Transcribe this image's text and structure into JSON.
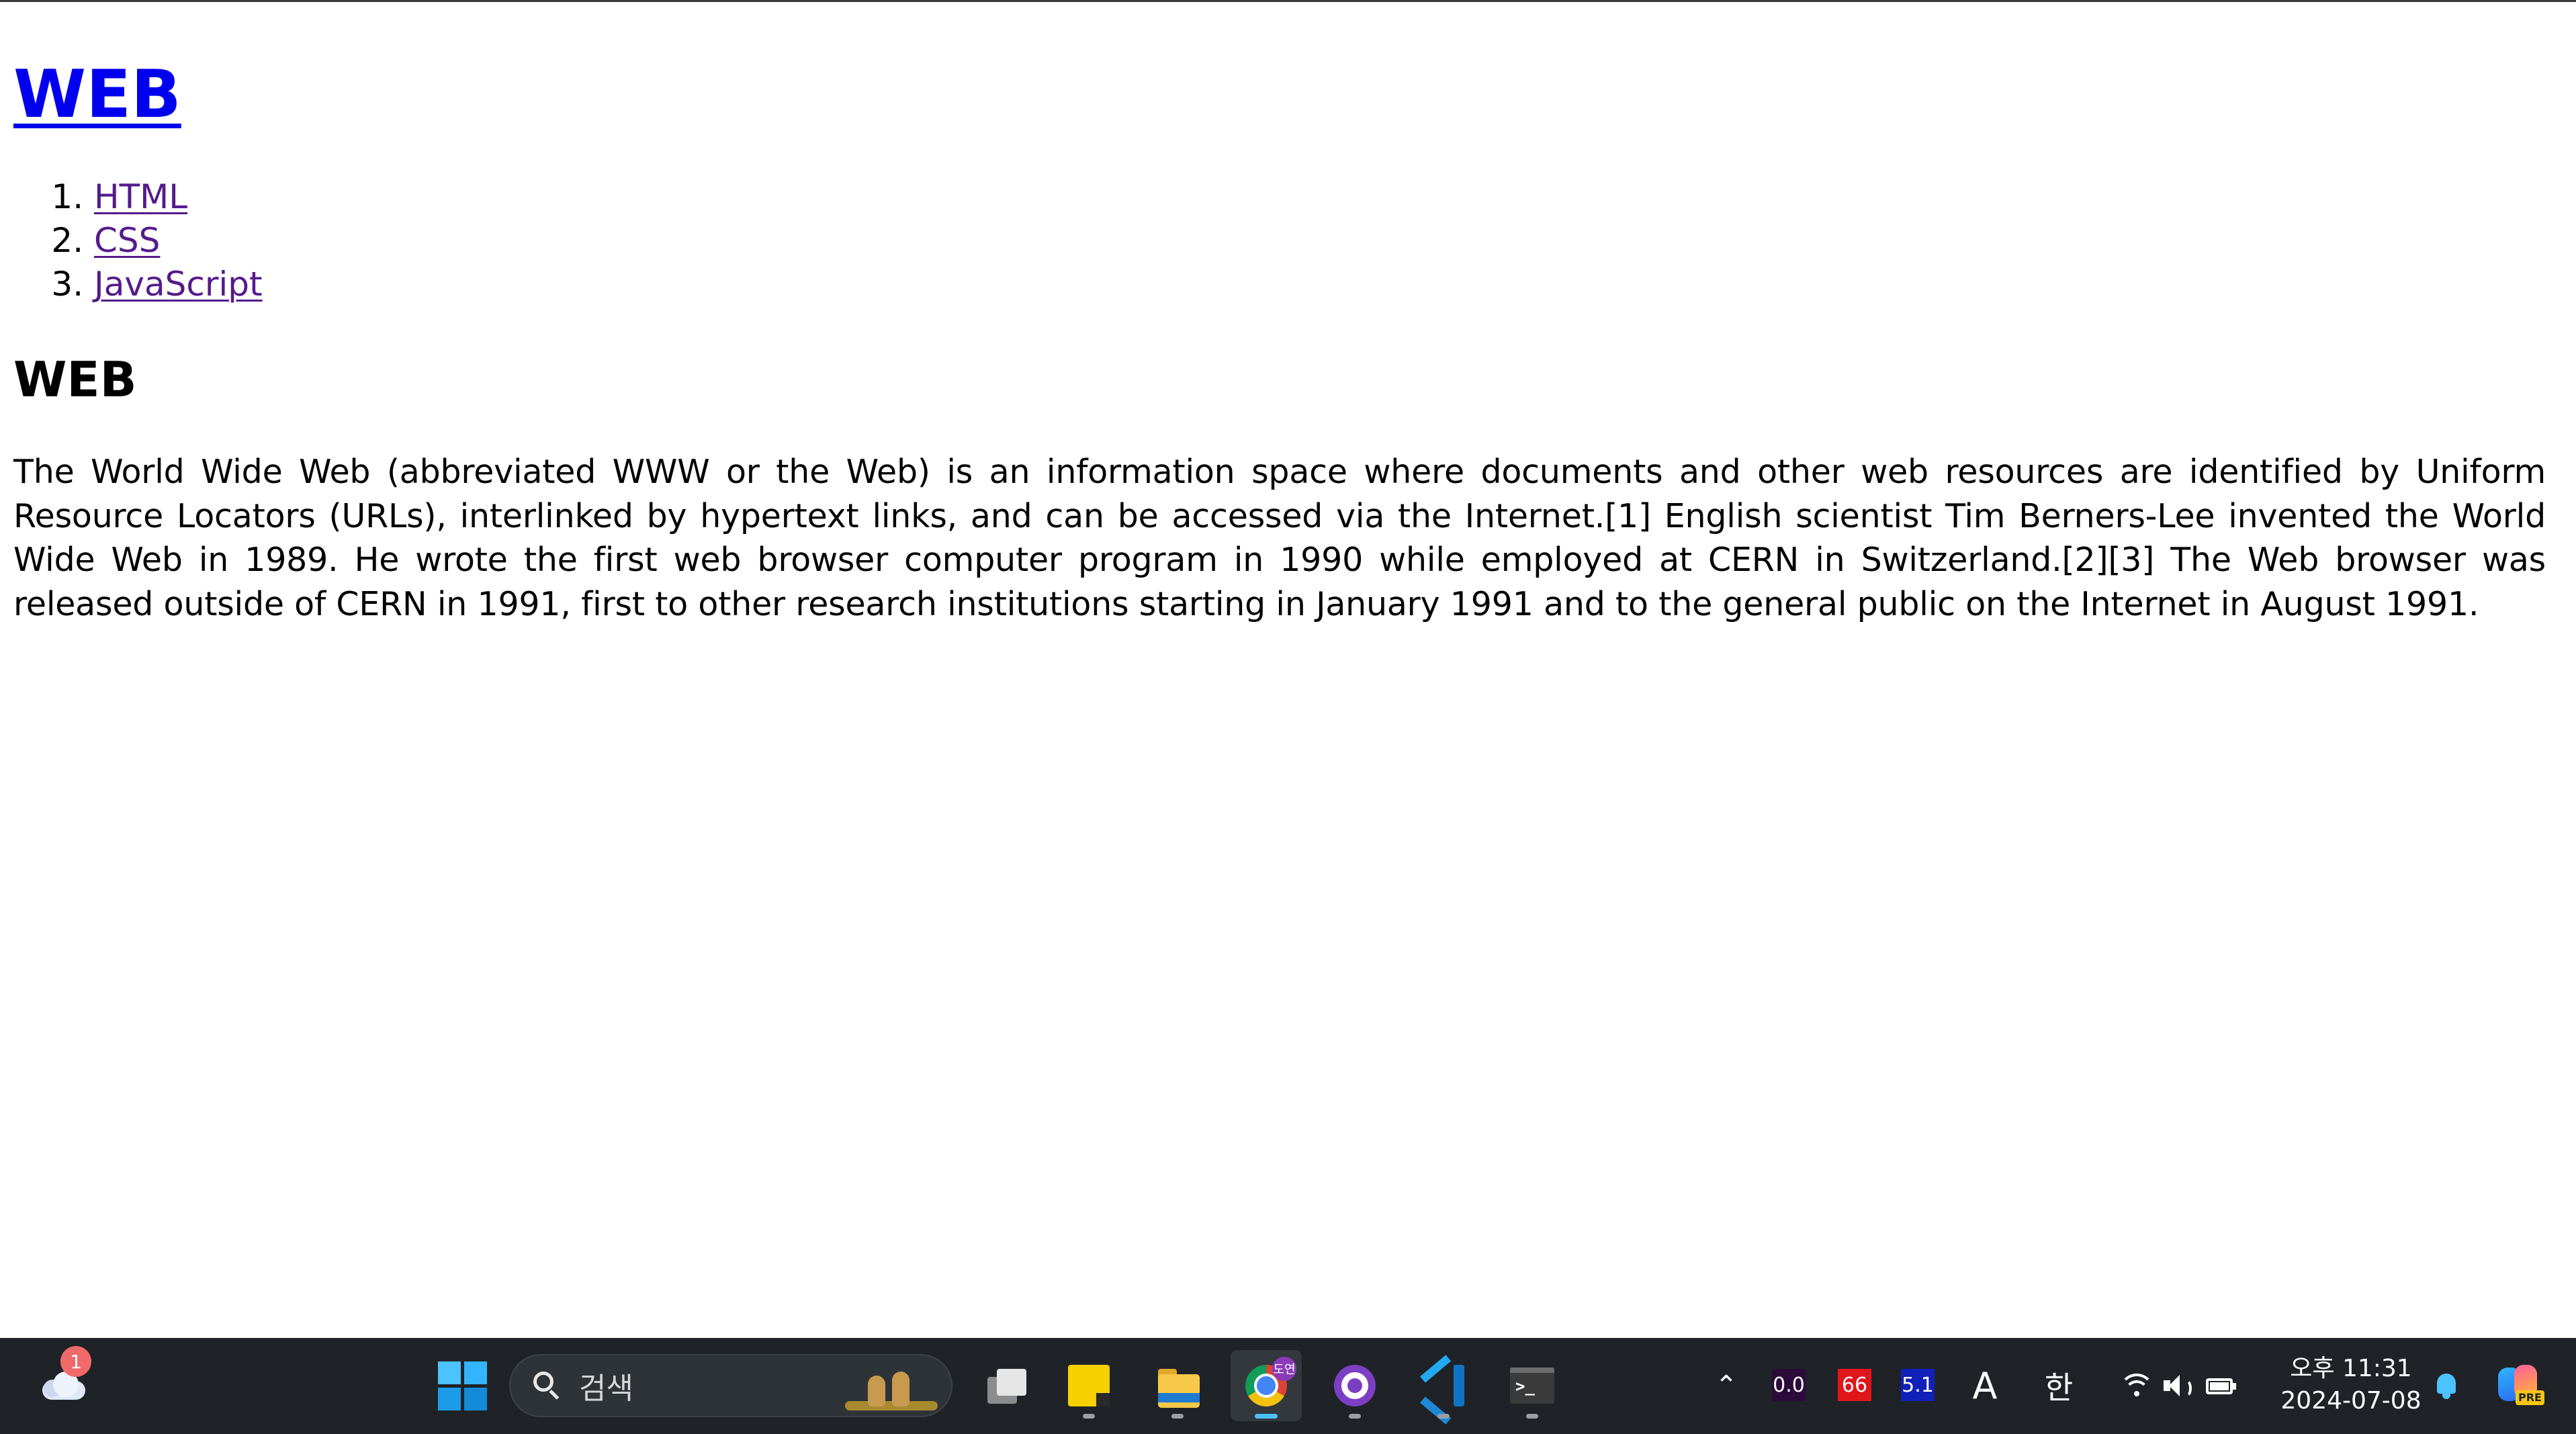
{
  "page": {
    "site_title": "WEB",
    "nav": [
      {
        "label": "HTML"
      },
      {
        "label": "CSS"
      },
      {
        "label": "JavaScript"
      }
    ],
    "section_title": "WEB",
    "article": "The World Wide Web (abbreviated WWW or the Web) is an information space where documents and other web resources are identified by Uniform Resource Locators (URLs), interlinked by hypertext links, and can be accessed via the Internet.[1] English scientist Tim Berners-Lee invented the World Wide Web in 1989. He wrote the first web browser computer program in 1990 while employed at CERN in Switzerland.[2][3] The Web browser was released outside of CERN in 1991, first to other research institutions starting in January 1991 and to the general public on the Internet in August 1991."
  },
  "taskbar": {
    "weather_badge": "1",
    "search_placeholder": "검색",
    "chrome_profile_label": "도연",
    "apps": [
      {
        "icon": "task-view-icon"
      },
      {
        "icon": "sticky-notes-icon"
      },
      {
        "icon": "file-explorer-icon"
      },
      {
        "icon": "chrome-icon",
        "active": true
      },
      {
        "icon": "github-desktop-icon"
      },
      {
        "icon": "vscode-icon"
      },
      {
        "icon": "terminal-icon"
      }
    ],
    "tray": {
      "cpu": "0.0",
      "ram": "66",
      "gpu": "5.1",
      "ime_mode": "A",
      "ime_lang": "한",
      "copilot_badge": "PRE"
    },
    "clock": {
      "time": "오후 11:31",
      "date": "2024-07-08"
    },
    "colors": {
      "taskbar_bg": "#1f2327",
      "accent": "#4cc2ff",
      "cpu_bg": "#2c0b3a",
      "ram_bg": "#e0161b",
      "gpu_bg": "#1020b8"
    }
  }
}
